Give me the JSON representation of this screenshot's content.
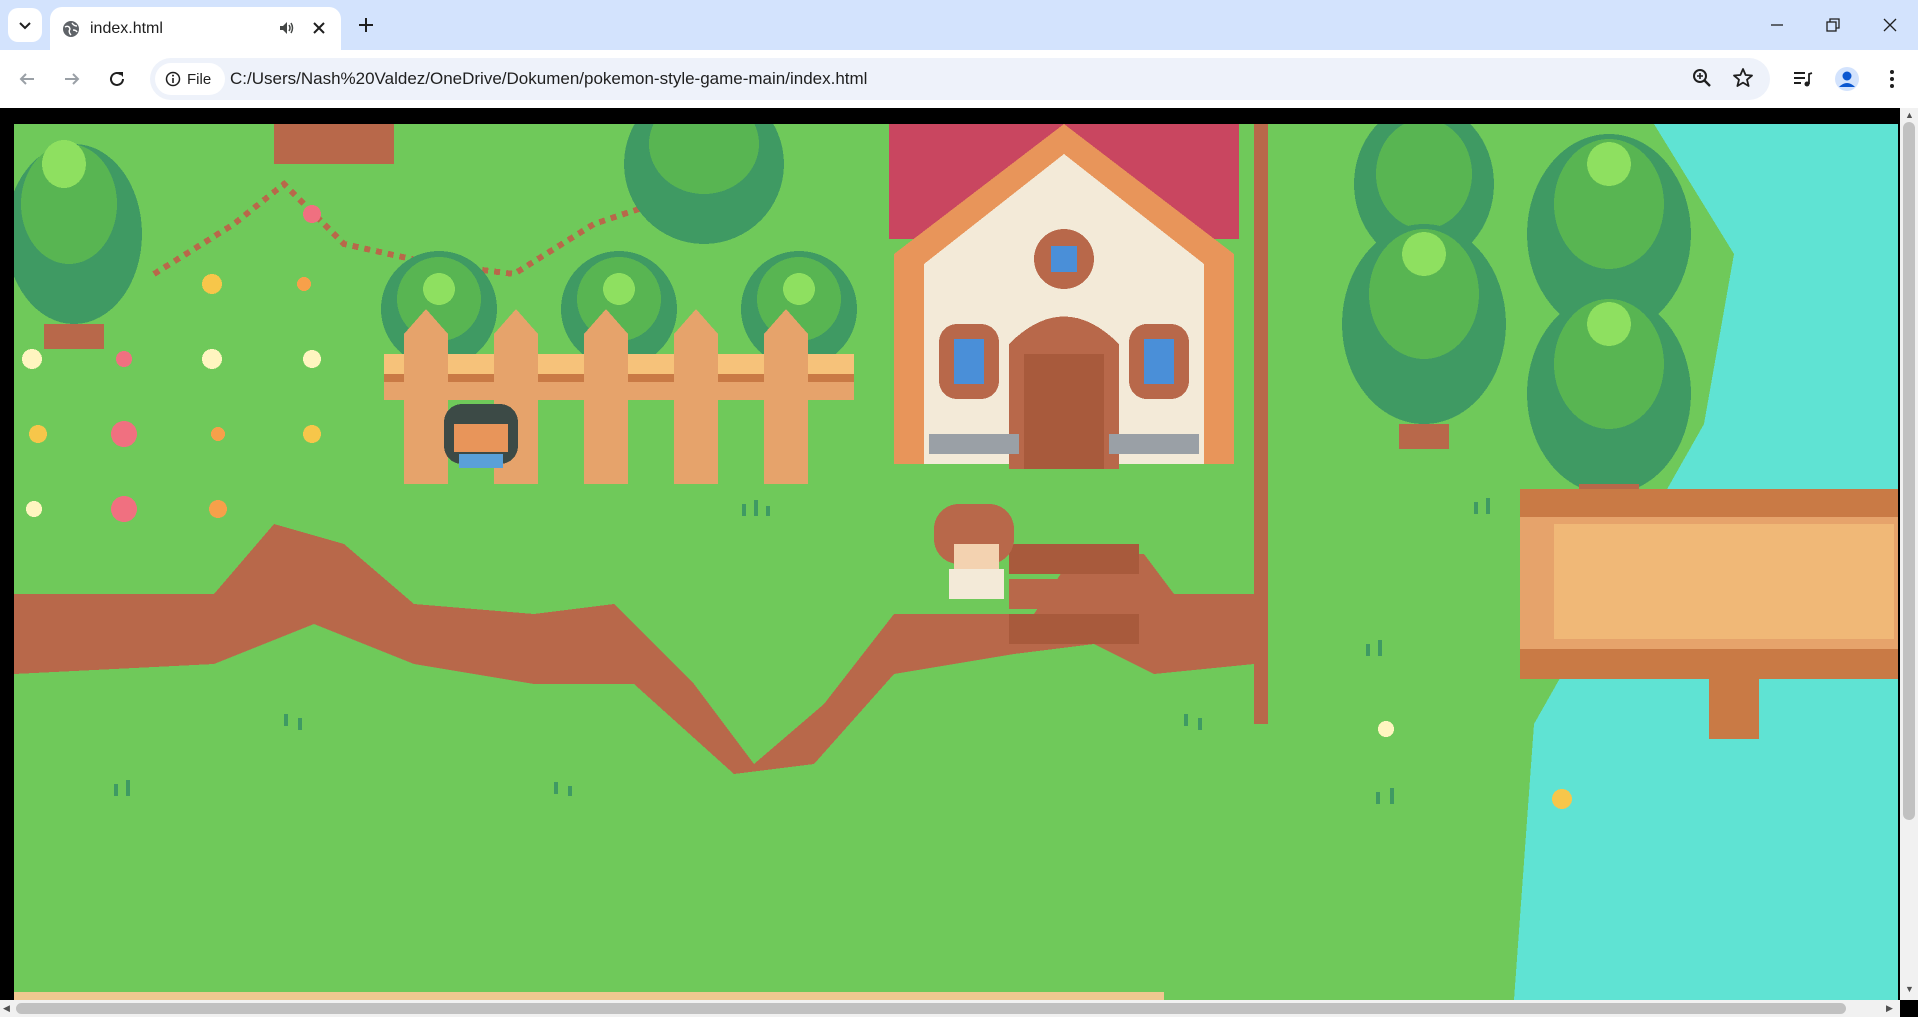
{
  "browser": {
    "tab": {
      "title": "index.html"
    },
    "address_bar": {
      "scheme_label": "File",
      "url": "C:/Users/Nash%20Valdez/OneDrive/Dokumen/pokemon-style-game-main/index.html"
    },
    "icons": {
      "tab_search": "chevron-down-icon",
      "favicon": "globe-icon",
      "audio": "speaker-icon",
      "close_tab": "close-icon",
      "new_tab": "plus-icon",
      "back": "back-arrow-icon",
      "forward": "forward-arrow-icon",
      "reload": "reload-icon",
      "site_info": "info-icon",
      "zoom": "zoom-icon",
      "bookmark": "star-icon",
      "media": "media-controls-icon",
      "profile": "avatar-icon",
      "menu": "kebab-menu-icon"
    },
    "colors": {
      "tab_strip": "#d3e3fd",
      "omnibox": "#eef2fa",
      "text": "#1f1f1f"
    }
  },
  "game": {
    "scene": "pixel-art village overworld",
    "colors": {
      "grass": "#6fc95a",
      "cliff": "#b8684a",
      "tree_dark": "#3f9a63",
      "tree_light": "#7bd35a",
      "water": "#5fe3d3",
      "roof": "#c94660",
      "wood": "#e6a36b"
    }
  }
}
